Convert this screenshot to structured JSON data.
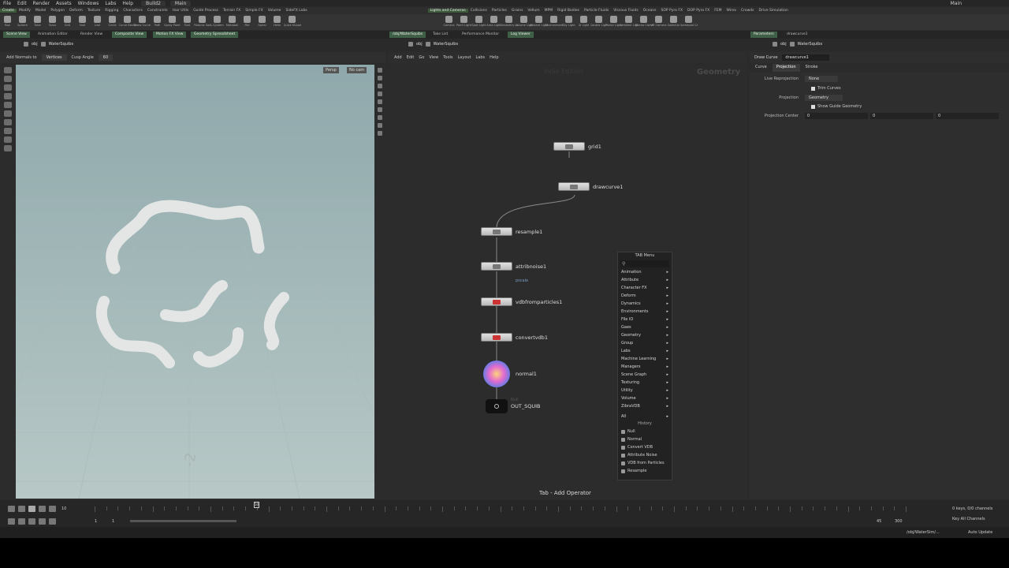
{
  "menubar": {
    "items": [
      "File",
      "Edit",
      "Render",
      "Assets",
      "Windows",
      "Labs",
      "Help"
    ],
    "desktop": "Build2",
    "context": "Main",
    "right": "Main"
  },
  "shelf_tabs_left": [
    "Create",
    "Modify",
    "Model",
    "Polygon",
    "Deform",
    "Texture",
    "Rigging",
    "Characters",
    "Constraints",
    "Hair Utils",
    "Guide Process",
    "Terrain FX",
    "Simple FX",
    "Volume",
    "SideFX Labs"
  ],
  "shelf_tabs_right": [
    "Lights and Cameras",
    "Collisions",
    "Particles",
    "Grains",
    "Vellum",
    "MPM",
    "Rigid Bodies",
    "Particle Fluids",
    "Viscous Fluids",
    "Oceans",
    "SOP Pyro FX",
    "DOP Pyro FX",
    "FEM",
    "Wires",
    "Crowds",
    "Drive Simulation"
  ],
  "shelf_tools_left": [
    "Box",
    "Sphere",
    "Tube",
    "Torus",
    "Grid",
    "Null",
    "Line",
    "Circle",
    "Curve Bezier",
    "Draw Curve",
    "Path",
    "Spray Paint",
    "Font",
    "Platonic Solids",
    "L-System",
    "Metaball",
    "File",
    "Spiral",
    "Helix",
    "Quick Shapes"
  ],
  "shelf_tools_right": [
    "Camera",
    "Point Light",
    "Spot Light",
    "Area Light",
    "Geometry Light",
    "Volume Light",
    "Distant Light",
    "Environment Light",
    "Sky Light",
    "GI Light",
    "Caustic Light",
    "Portal Light",
    "Ambient Light",
    "Stereo Camera",
    "VR Camera",
    "Switcher",
    "Gamepad Camera"
  ],
  "pane_tabs": {
    "left": [
      "Scene View",
      "Animation Editor",
      "Render View",
      "Composite View",
      "Motion FX View",
      "Geometry Spreadsheet"
    ],
    "mid": [
      "/obj/WaterSquibs",
      "Take List",
      "Performance Monitor",
      "Log Viewer"
    ],
    "right": [
      "Parameters",
      "drawcurve1"
    ]
  },
  "paths": {
    "left": [
      "obj",
      "WaterSquibs"
    ],
    "mid": [
      "obj",
      "WaterSquibs"
    ],
    "right": [
      "obj",
      "WaterSquibs"
    ]
  },
  "viewport": {
    "toolbar": {
      "label1": "Add Normals to",
      "value1": "Vertices",
      "label2": "Cusp Angle",
      "value2": "60"
    },
    "camera": "Persp",
    "cam2": "No cam",
    "axis_label": "-2"
  },
  "network": {
    "menu": [
      "Add",
      "Edit",
      "Go",
      "View",
      "Tools",
      "Layout",
      "Labs",
      "Help"
    ],
    "watermark": "Indie Edition",
    "context_label": "Geometry",
    "nodes": [
      {
        "name": "grid1"
      },
      {
        "name": "drawcurve1"
      },
      {
        "name": "resample1"
      },
      {
        "name": "attribnoise1"
      },
      {
        "name": "vdbfromparticles1"
      },
      {
        "name": "convertvdb1"
      },
      {
        "name": "normal1"
      },
      {
        "name": "OUT_SQUIB"
      }
    ],
    "attrib_sub": "pscale",
    "null_sub": "Null",
    "hint": "Tab - Add Operator"
  },
  "tab_menu": {
    "title": "TAB Menu",
    "items": [
      "Animation",
      "Attribute",
      "Character FX",
      "Deform",
      "Dynamics",
      "Environments",
      "File IO",
      "Gaes",
      "Geometry",
      "Group",
      "Labs",
      "Machine Learning",
      "Managers",
      "Scene Graph",
      "Texturing",
      "Utility",
      "Volume",
      "ZibraVDB"
    ],
    "all": "All",
    "history_title": "History",
    "history": [
      "Null",
      "Normal",
      "Convert VDB",
      "Attribute Noise",
      "VDB from Particles",
      "Resample"
    ]
  },
  "params": {
    "node_type": "Draw Curve",
    "node_name": "drawcurve1",
    "tabs": [
      "Curve",
      "Projection",
      "Stroke"
    ],
    "live_reprojection_label": "Live Reprojection",
    "live_reprojection_value": "None",
    "trim_curves": "Trim Curves",
    "projection_label": "Projection",
    "projection_value": "Geometry",
    "show_guide": "Show Guide Geometry",
    "projection_center_label": "Projection Center",
    "projection_center": [
      "0",
      "0",
      "0"
    ]
  },
  "timeline": {
    "frame": "10",
    "current": "10",
    "start": "1",
    "start2": "1",
    "end1": "45",
    "end2": "300",
    "keys": "0 keys, 0/0 channels",
    "keys_all": "Key All Channels"
  },
  "status": {
    "path": "/obj/WaterSim/...",
    "update": "Auto Update"
  }
}
